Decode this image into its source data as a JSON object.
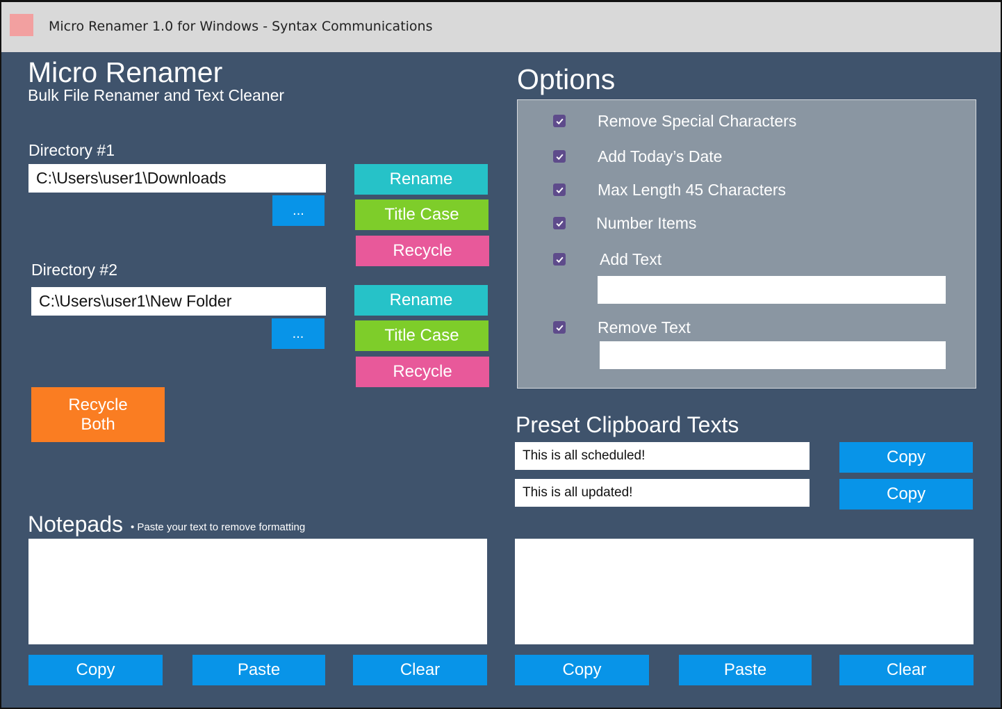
{
  "window": {
    "title": "Micro Renamer 1.0 for Windows - Syntax Communications"
  },
  "app": {
    "title": "Micro Renamer",
    "subtitle": "Bulk File Renamer and Text Cleaner"
  },
  "directories": [
    {
      "label": "Directory #1",
      "path": "C:\\Users\\user1\\Downloads",
      "browse_label": "...",
      "rename_label": "Rename",
      "title_case_label": "Title Case",
      "recycle_label": "Recycle"
    },
    {
      "label": "Directory #2",
      "path": "C:\\Users\\user1\\New Folder",
      "browse_label": "...",
      "rename_label": "Rename",
      "title_case_label": "Title Case",
      "recycle_label": "Recycle"
    }
  ],
  "recycle_both": {
    "line1": "Recycle",
    "line2": "Both"
  },
  "options": {
    "title": "Options",
    "items": [
      {
        "label": "Remove Special Characters",
        "checked": true
      },
      {
        "label": "Add Today’s Date",
        "checked": true
      },
      {
        "label": "Max Length 45 Characters",
        "checked": true
      },
      {
        "label": "Number Items",
        "checked": true
      },
      {
        "label": "Add Text",
        "checked": true,
        "value": ""
      },
      {
        "label": "Remove Text",
        "checked": true,
        "value": ""
      }
    ]
  },
  "presets": {
    "title": "Preset Clipboard Texts",
    "items": [
      {
        "text": "This is all scheduled!",
        "copy_label": "Copy"
      },
      {
        "text": "This is all updated!",
        "copy_label": "Copy"
      }
    ]
  },
  "notepads": {
    "title": "Notepads",
    "hint": "Paste your text to remove formatting",
    "pads": [
      {
        "text": "",
        "copy_label": "Copy",
        "paste_label": "Paste",
        "clear_label": "Clear"
      },
      {
        "text": "",
        "copy_label": "Copy",
        "paste_label": "Paste",
        "clear_label": "Clear"
      }
    ]
  },
  "colors": {
    "background": "#3f536c",
    "rename": "#26c2c8",
    "title_case": "#7ecd2a",
    "recycle": "#e8599a",
    "action_blue": "#0894e8",
    "recycle_both": "#fa7d22",
    "options_panel": "#8a96a2",
    "checkbox": "#5e4b8b"
  }
}
